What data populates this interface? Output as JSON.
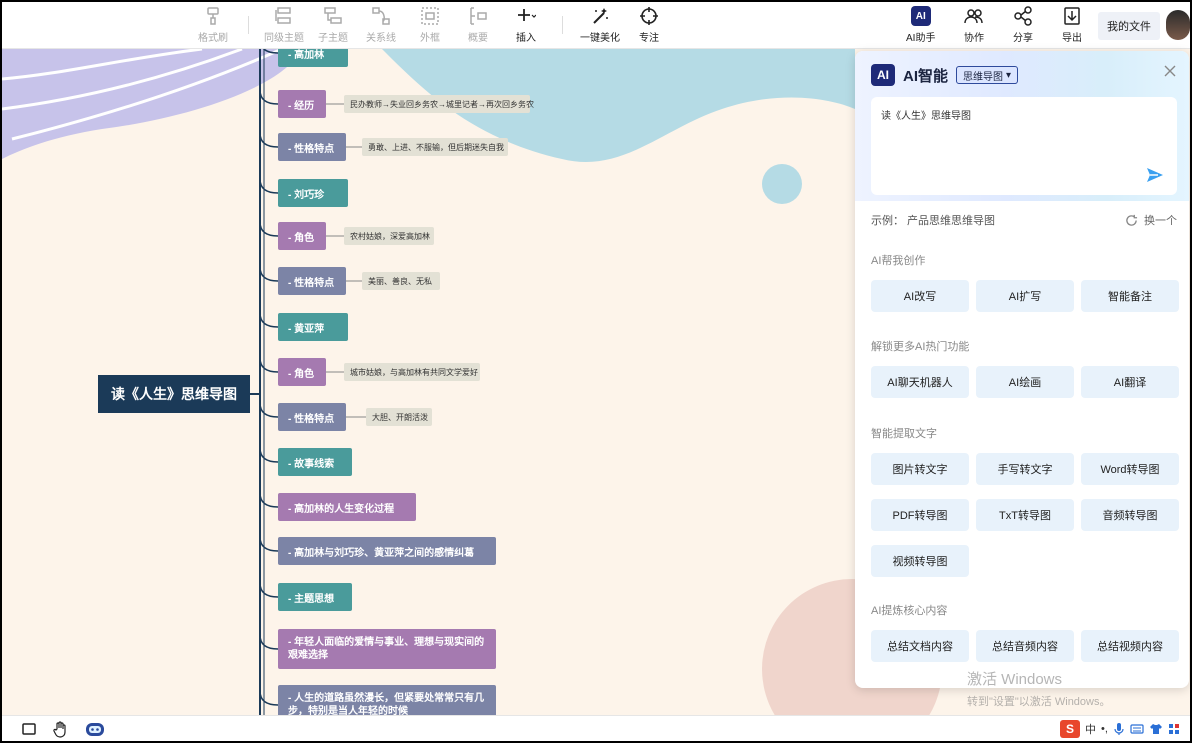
{
  "toolbar": {
    "items": [
      {
        "name": "format-brush",
        "label": "格式刷",
        "icon": "brush-icon"
      },
      {
        "name": "sibling-topic",
        "label": "同级主题",
        "icon": "sibling-icon"
      },
      {
        "name": "sub-topic",
        "label": "子主题",
        "icon": "subtopic-icon"
      },
      {
        "name": "relation-line",
        "label": "关系线",
        "icon": "relation-icon"
      },
      {
        "name": "frame",
        "label": "外框",
        "icon": "frame-icon"
      },
      {
        "name": "summary",
        "label": "概要",
        "icon": "summary-icon"
      },
      {
        "name": "insert",
        "label": "插入",
        "icon": "plus-icon"
      },
      {
        "name": "one-click-beautify",
        "label": "一键美化",
        "icon": "magic-wand-icon"
      },
      {
        "name": "focus",
        "label": "专注",
        "icon": "target-icon"
      },
      {
        "name": "ai-assistant",
        "label": "AI助手",
        "icon": "ai-icon"
      },
      {
        "name": "collaborate",
        "label": "协作",
        "icon": "people-icon"
      },
      {
        "name": "share",
        "label": "分享",
        "icon": "share-icon"
      },
      {
        "name": "export",
        "label": "导出",
        "icon": "download-icon"
      }
    ],
    "ai_badge": "AI",
    "my_files": "我的文件"
  },
  "mindmap": {
    "root": "读《人生》思维导图",
    "nodes": [
      {
        "text": "- 高加林",
        "color": "teal"
      },
      {
        "text": "- 经历",
        "color": "purple",
        "leaf": "民办教师→失业回乡务农→城里记者→再次回乡务农"
      },
      {
        "text": "- 性格特点",
        "color": "slate",
        "leaf": "勇敢、上进、不服输，但后期迷失自我"
      },
      {
        "text": "- 刘巧珍",
        "color": "teal"
      },
      {
        "text": "- 角色",
        "color": "purple",
        "leaf": "农村姑娘，深爱高加林"
      },
      {
        "text": "- 性格特点",
        "color": "slate",
        "leaf": "美丽、善良、无私"
      },
      {
        "text": "- 黄亚萍",
        "color": "teal"
      },
      {
        "text": "- 角色",
        "color": "purple",
        "leaf": "城市姑娘，与高加林有共同文学爱好"
      },
      {
        "text": "- 性格特点",
        "color": "slate",
        "leaf": "大胆、开朗活泼"
      },
      {
        "text": "- 故事线索",
        "color": "teal"
      },
      {
        "text": "- 高加林的人生变化过程",
        "color": "purple"
      },
      {
        "text": "- 高加林与刘巧珍、黄亚萍之间的感情纠葛",
        "color": "slate"
      },
      {
        "text": "- 主题思想",
        "color": "teal"
      },
      {
        "text": "- 年轻人面临的爱情与事业、理想与现实间的艰难选择",
        "color": "purple"
      },
      {
        "text": "- 人生的道路虽然漫长，但紧要处常常只有几步，特别是当人年轻的时候",
        "color": "slate"
      }
    ]
  },
  "ai_panel": {
    "logo": "AI",
    "title": "AI智能",
    "mode": "思维导图",
    "input_value": "读《人生》思维导图",
    "example_label": "示例：  产品思维思维导图",
    "refresh_label": "换一个",
    "sections": [
      {
        "title": "AI帮我创作",
        "buttons": [
          "AI改写",
          "AI扩写",
          "智能备注"
        ]
      },
      {
        "title": "解锁更多AI热门功能",
        "buttons": [
          "AI聊天机器人",
          "AI绘画",
          "AI翻译"
        ]
      },
      {
        "title": "智能提取文字",
        "buttons": [
          "图片转文字",
          "手写转文字",
          "Word转导图",
          "PDF转导图",
          "TxT转导图",
          "音频转导图",
          "视频转导图"
        ]
      },
      {
        "title": "AI提炼核心内容",
        "buttons": [
          "总结文档内容",
          "总结音频内容",
          "总结视频内容"
        ]
      }
    ]
  },
  "watermark": {
    "line1": "激活 Windows",
    "line2": "转到\"设置\"以激活 Windows。"
  },
  "ime": {
    "logo": "S",
    "lang": "中",
    "punct": "•,"
  },
  "colors": {
    "teal": "#4a9b9b",
    "purple": "#a57ab0",
    "slate": "#7c84a6",
    "root": "#1b3a58",
    "ai_navy": "#1e2a78",
    "button_bg": "#e8f2fb"
  }
}
